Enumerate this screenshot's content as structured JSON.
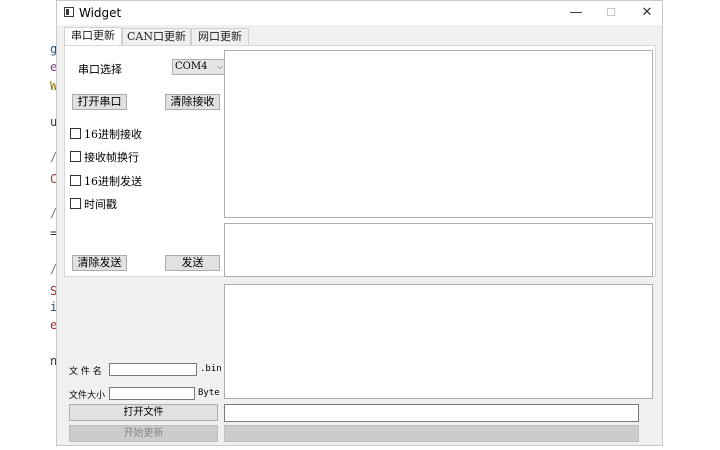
{
  "window": {
    "title": "Widget",
    "minimize_glyph": "—",
    "maximize_glyph": "☐",
    "close_glyph": "✕"
  },
  "tabs": [
    {
      "label": "串口更新",
      "active": true
    },
    {
      "label": "CAN口更新",
      "active": false
    },
    {
      "label": "网口更新",
      "active": false
    }
  ],
  "serial": {
    "port_label": "串口选择",
    "port_value": "COM4",
    "open_button": "打开串口",
    "clear_receive_button": "清除接收",
    "checkboxes": [
      {
        "label": "16进制接收",
        "checked": false
      },
      {
        "label": "接收帧换行",
        "checked": false
      },
      {
        "label": "16进制发送",
        "checked": false
      },
      {
        "label": "时间戳",
        "checked": false
      }
    ],
    "clear_send_button": "清除发送",
    "send_button": "发送"
  },
  "file": {
    "name_label": "文 件 名",
    "name_suffix": ".bin",
    "size_label": "文件大小",
    "size_suffix": "Byte",
    "open_file_button": "打开文件",
    "start_update_button": "开始更新"
  },
  "background_code": {
    "glyphs": [
      "g",
      "e",
      "W",
      "u",
      "/",
      "C",
      "/",
      "=",
      "/",
      "S",
      "i",
      "e",
      "n"
    ],
    "colors": [
      "#1c5a8a",
      "#8b3a8b",
      "#8a7a00",
      "#333333",
      "#777777",
      "#a03030",
      "#777777",
      "#333333",
      "#777777",
      "#a03030",
      "#1c5a8a",
      "#a03030",
      "#333333"
    ]
  },
  "colors": {
    "window_bg": "#f0f0f0",
    "panel_bg": "#ffffff",
    "button_bg": "#e1e1e1",
    "disabled_button_bg": "#cccccc"
  }
}
